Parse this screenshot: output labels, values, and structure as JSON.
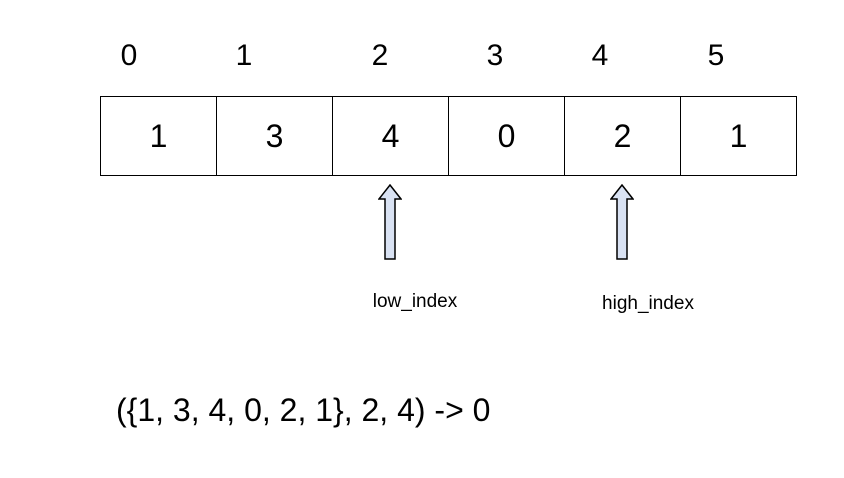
{
  "indices": [
    "0",
    "1",
    "2",
    "3",
    "4",
    "5"
  ],
  "array": [
    "1",
    "3",
    "4",
    "0",
    "2",
    "1"
  ],
  "pointers": {
    "low": {
      "label": "low_index"
    },
    "high": {
      "label": "high_index"
    }
  },
  "expression": "({1, 3, 4, 0, 2, 1}, 2, 4) -> 0",
  "colors": {
    "arrow_fill": "#d9e2f3",
    "arrow_stroke": "#000000"
  }
}
